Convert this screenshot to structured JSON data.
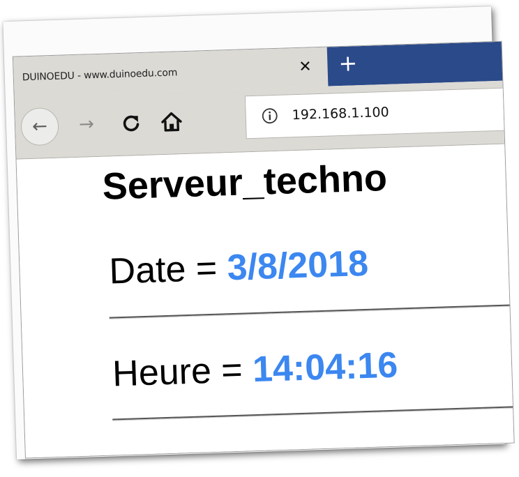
{
  "tab": {
    "title": "DUINOEDU - www.duinoedu.com",
    "close_glyph": "✕",
    "new_tab_glyph": "+"
  },
  "toolbar": {
    "back_icon": "back-arrow-icon",
    "forward_icon": "forward-arrow-icon",
    "reload_icon": "reload-icon",
    "home_icon": "home-icon",
    "back_glyph": "←",
    "forward_glyph": "→"
  },
  "address": {
    "info_icon": "info-icon",
    "url": "192.168.1.100"
  },
  "page": {
    "heading": "Serveur_techno",
    "date_label": "Date = ",
    "date_value": "3/8/2018",
    "time_label": "Heure = ",
    "time_value": "14:04:16"
  },
  "colors": {
    "value_accent": "#3c87f0",
    "new_tab_bg": "#2b4a8a",
    "chrome_bg": "#dcdad5"
  }
}
